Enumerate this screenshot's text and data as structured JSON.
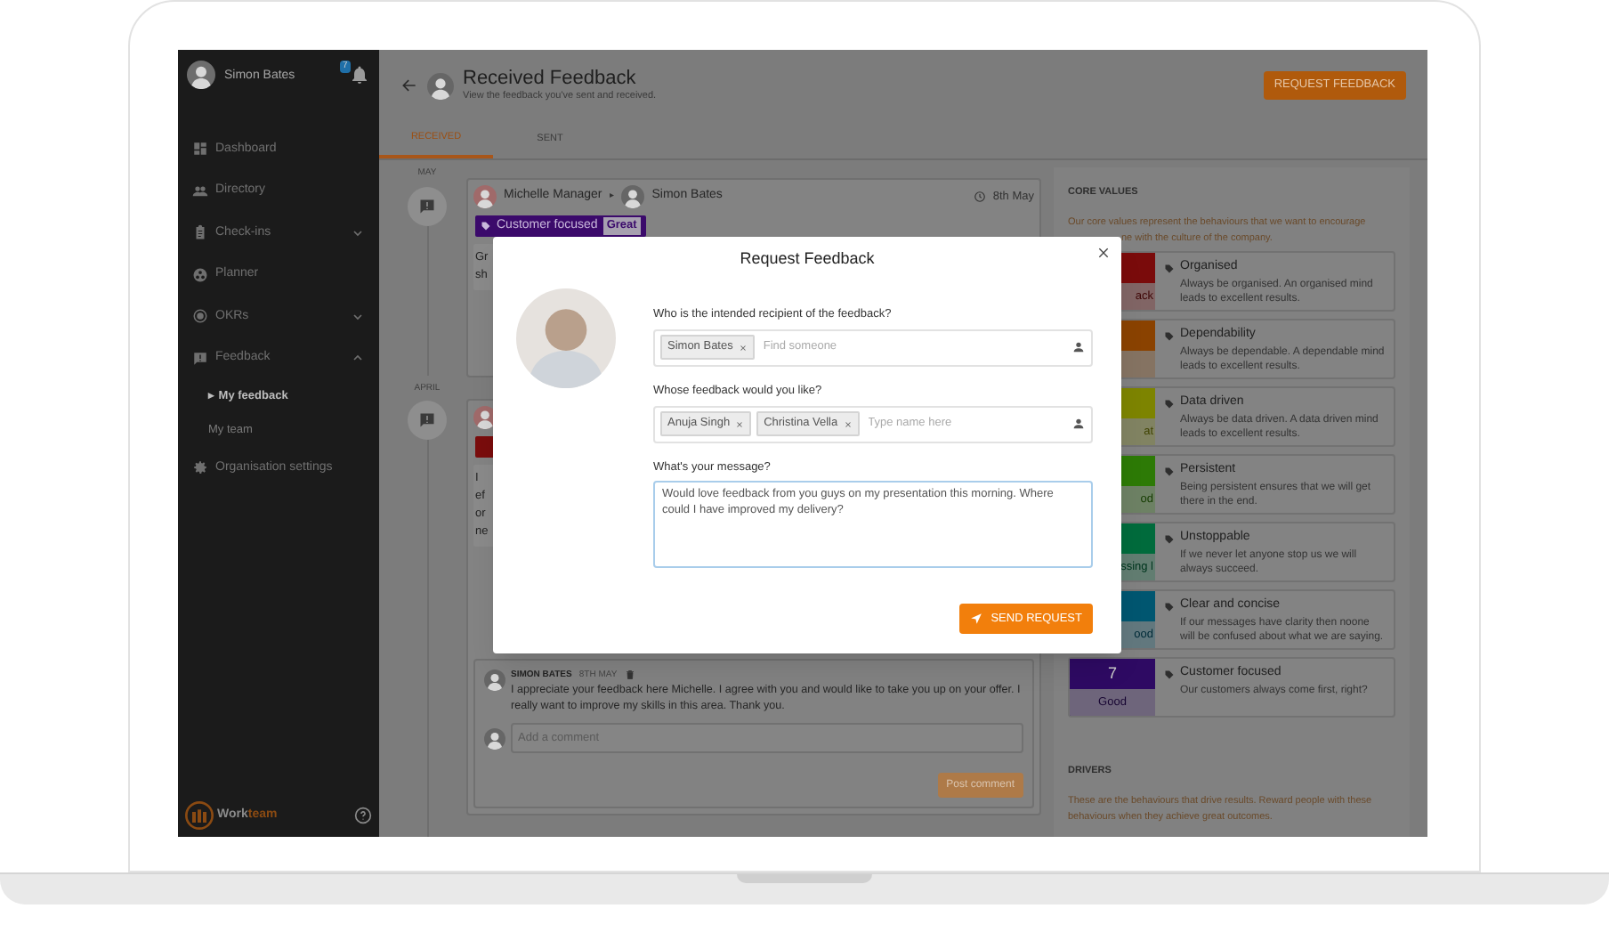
{
  "sidebar": {
    "user_name": "Simon Bates",
    "notification_count": "7",
    "items": [
      {
        "label": "Dashboard"
      },
      {
        "label": "Directory"
      },
      {
        "label": "Check-ins",
        "expanded": false
      },
      {
        "label": "Planner"
      },
      {
        "label": "OKRs",
        "expanded": false
      },
      {
        "label": "Feedback",
        "expanded": true,
        "children": [
          {
            "label": "My feedback",
            "selected": true,
            "marker": "▸"
          },
          {
            "label": "My team",
            "selected": false
          }
        ]
      },
      {
        "label": "Organisation settings"
      }
    ],
    "logo": {
      "part_1": "Work",
      "part_2": "team"
    }
  },
  "header": {
    "title": "Received Feedback",
    "subtitle": "View the feedback you've sent and received.",
    "button": "REQUEST FEEDBACK"
  },
  "tabs": [
    {
      "label": "RECEIVED",
      "selected": true
    },
    {
      "label": "SENT",
      "selected": false
    }
  ],
  "feedback": [
    {
      "month": "MAY",
      "from": "Michelle Manager",
      "arrow": "▸",
      "to": "Simon Bates",
      "date": "8th May",
      "value": {
        "label": "Customer focused",
        "rating": "Great",
        "color": "#3b0a6b"
      },
      "body_fragments": [
        "Gr",
        "sh"
      ]
    },
    {
      "month": "APRIL",
      "value": {
        "color": "#7a0d0d"
      },
      "body_fragments": [
        "I",
        "ef",
        "or",
        "ne"
      ],
      "comment": {
        "author": "SIMON BATES",
        "date": "8TH MAY",
        "text": "I appreciate your feedback here Michelle. I agree with you and would like to take you up on your offer. I really want to improve my skills in this area. Thank you.",
        "placeholder": "Add a comment",
        "button": "Post comment"
      }
    }
  ],
  "core_values": {
    "title": "CORE VALUES",
    "description": [
      "Our core values represent the behaviours that we want to encourage",
      "ne with the culture of the company."
    ],
    "items": [
      {
        "name": "Organised",
        "description": "Always be organised. An organised mind leads to excellent results.",
        "rating": "ack",
        "color": "#7a0b0b"
      },
      {
        "name": "Dependability",
        "description": "Always be dependable. A dependable mind leads to excellent results.",
        "color": "#8a4200"
      },
      {
        "name": "Data driven",
        "description": "Always be data driven. A data driven mind leads to excellent results.",
        "rating": "at",
        "color": "#7d8400"
      },
      {
        "name": "Persistent",
        "description": "Being persistent ensures that we will get there in the end.",
        "rating": "od",
        "color": "#2d7a06"
      },
      {
        "name": "Unstoppable",
        "description": "If we never let anyone stop us we will always succeed.",
        "rating": "ssing l",
        "color": "#006b3c"
      },
      {
        "name": "Clear and concise",
        "description": "If our messages have clarity then noone will be confused about what we are saying.",
        "rating": "ood",
        "color": "#005670"
      },
      {
        "name": "Customer focused",
        "description": "Our customers always come first, right?",
        "score": "7",
        "rating": "Good",
        "color": "#2e0a63"
      }
    ]
  },
  "drivers": {
    "title": "DRIVERS",
    "description": "These are the behaviours that drive results. Reward people with these behaviours when they achieve great outcomes."
  },
  "modal": {
    "title": "Request Feedback",
    "recipient": {
      "label": "Who is the intended recipient of the feedback?",
      "chips": [
        "Simon Bates"
      ],
      "placeholder": "Find someone"
    },
    "givers": {
      "label": "Whose feedback would you like?",
      "chips": [
        "Anuja Singh",
        "Christina Vella"
      ],
      "placeholder": "Type name here"
    },
    "message": {
      "label": "What's your message?",
      "value": "Would love feedback from you guys on my presentation this morning. Where could I have improved my delivery?"
    },
    "button": "SEND REQUEST"
  }
}
